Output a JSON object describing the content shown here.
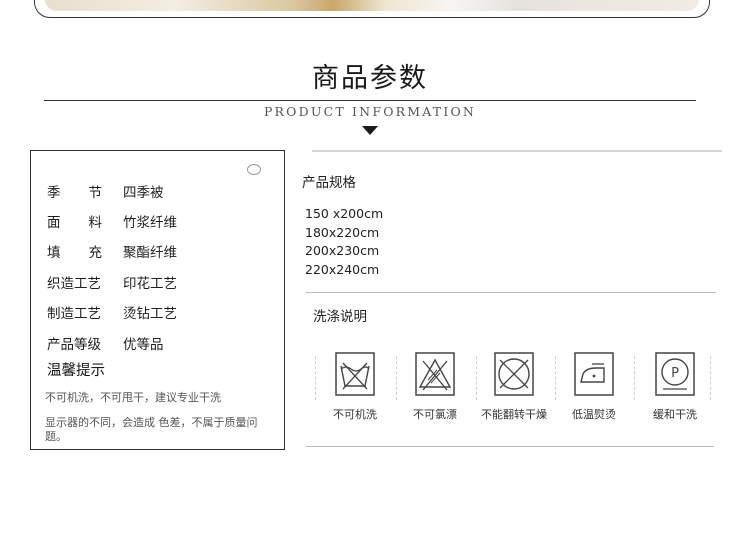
{
  "title": "商品参数",
  "subtitle": "PRODUCT INFORMATION",
  "tag": {
    "specs": [
      {
        "key": "季节",
        "value": "四季被"
      },
      {
        "key": "面料",
        "value": "竹浆纤维"
      },
      {
        "key": "填充",
        "value": "聚酯纤维"
      },
      {
        "key": "织造工艺",
        "value": "印花工艺"
      },
      {
        "key": "制造工艺",
        "value": "烫钻工艺"
      },
      {
        "key": "产品等级",
        "value": "优等品"
      }
    ],
    "tips_heading": "温馨提示",
    "tips_line1": "不可机洗，不可甩干，建议专业干洗",
    "tips_line2": "显示器的不同，会造成          色差，不属于质量问题。"
  },
  "size_section": {
    "label": "产品规格",
    "sizes": [
      "150 x200cm",
      "180x220cm",
      "200x230cm",
      "220x240cm"
    ]
  },
  "wash_section": {
    "label": "洗涤说明",
    "icons": [
      {
        "icon": "no-machine-wash-icon",
        "label": "不可机洗"
      },
      {
        "icon": "no-bleach-icon",
        "label": "不可氯漂"
      },
      {
        "icon": "no-tumble-dry-icon",
        "label": "不能翻转干燥"
      },
      {
        "icon": "low-iron-icon",
        "label": "低温熨烫"
      },
      {
        "icon": "gentle-dry-clean-icon",
        "label": "缓和干洗"
      }
    ]
  }
}
